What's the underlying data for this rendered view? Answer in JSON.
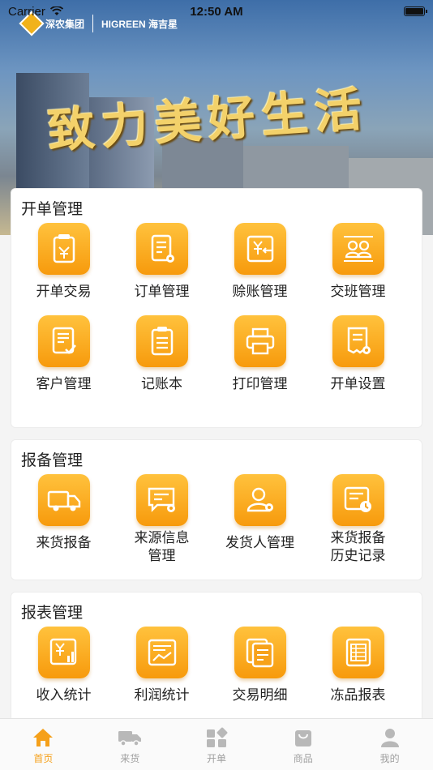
{
  "status_bar": {
    "carrier": "Carrier",
    "time": "12:50 AM"
  },
  "banner": {
    "logo_left": "深农集团",
    "logo_right": "HIGREEN 海吉星",
    "slogan": "致力美好生活"
  },
  "sections": [
    {
      "title": "开单管理",
      "items": [
        {
          "label": "开单交易",
          "icon": "receipt-yen-icon"
        },
        {
          "label": "订单管理",
          "icon": "order-list-gear-icon"
        },
        {
          "label": "赊账管理",
          "icon": "credit-yen-arrow-icon"
        },
        {
          "label": "交班管理",
          "icon": "shift-handover-icon"
        },
        {
          "label": "客户管理",
          "icon": "customer-check-icon"
        },
        {
          "label": "记账本",
          "icon": "ledger-icon"
        },
        {
          "label": "打印管理",
          "icon": "printer-icon"
        },
        {
          "label": "开单设置",
          "icon": "receipt-settings-icon"
        }
      ]
    },
    {
      "title": "报备管理",
      "items": [
        {
          "label": "来货报备",
          "icon": "truck-icon"
        },
        {
          "label": "来源信息管理",
          "icon": "source-info-gear-icon"
        },
        {
          "label": "发货人管理",
          "icon": "consignor-gear-icon"
        },
        {
          "label": "来货报备历史记录",
          "icon": "history-clock-icon"
        }
      ]
    },
    {
      "title": "报表管理",
      "items": [
        {
          "label": "收入统计",
          "icon": "income-chart-icon"
        },
        {
          "label": "利润统计",
          "icon": "profit-chart-icon"
        },
        {
          "label": "交易明细",
          "icon": "transaction-detail-icon"
        },
        {
          "label": "冻品报表",
          "icon": "frozen-report-icon"
        }
      ]
    }
  ],
  "tabbar": [
    {
      "label": "首页",
      "icon": "home-icon",
      "active": true
    },
    {
      "label": "来货",
      "icon": "truck-icon",
      "active": false
    },
    {
      "label": "开单",
      "icon": "grid-icon",
      "active": false
    },
    {
      "label": "商品",
      "icon": "bag-icon",
      "active": false
    },
    {
      "label": "我的",
      "icon": "user-icon",
      "active": false
    }
  ],
  "colors": {
    "accent": "#f5a01a",
    "icon_gradient_top": "#ffc23d",
    "icon_gradient_bottom": "#f79a0c"
  }
}
